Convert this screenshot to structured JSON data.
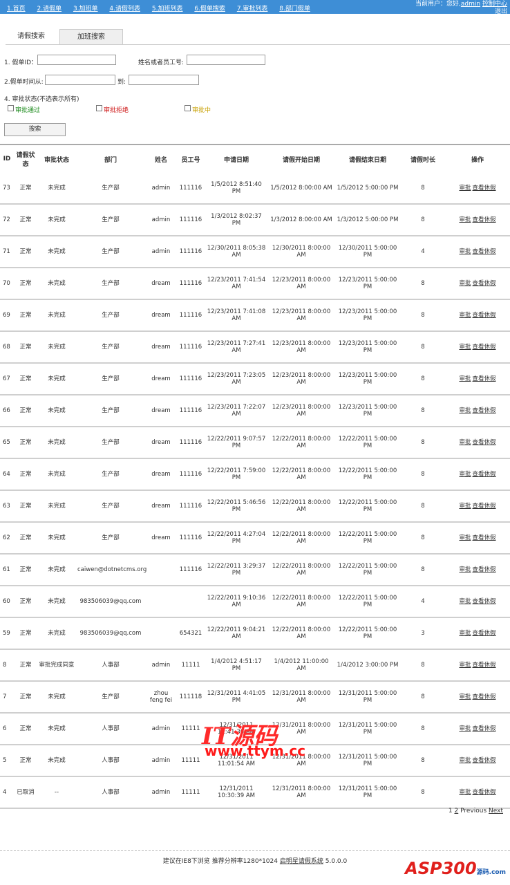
{
  "topnav": {
    "items": [
      "1.首页",
      "2.请假单",
      "3.加班单",
      "4.请假列表",
      "5.加班列表",
      "6.假单搜索",
      "7.审批列表",
      "8.部门假单"
    ],
    "user_prefix": "当前用户：您好,",
    "user_name": "admin",
    "control_center": "控制中心",
    "logout": "退出"
  },
  "tabs": [
    "请假搜索",
    "加班搜索"
  ],
  "form": {
    "leave_id_label": "1. 假单ID：",
    "name_label": "姓名或者员工号:",
    "time_from_label": "2.假单时间从:",
    "time_to_label": "到:",
    "status_label": "4. 审批状态(不选表示所有)",
    "status_options": [
      {
        "label": "审批通过",
        "color": "#1a8a1a"
      },
      {
        "label": "审批拒绝",
        "color": "#cc1111"
      },
      {
        "label": "审批中",
        "color": "#c8a000"
      }
    ],
    "search_button": "搜索"
  },
  "table": {
    "headers": [
      "ID",
      "请假状态",
      "审批状态",
      "部门",
      "姓名",
      "员工号",
      "申请日期",
      "请假开始日期",
      "请假结束日期",
      "请假时长",
      "操作"
    ],
    "op_approve": "审批",
    "op_view": "查看休假",
    "rows": [
      [
        "73",
        "正常",
        "未完成",
        "生产部",
        "admin",
        "111116",
        "1/5/2012 8:51:40 PM",
        "1/5/2012 8:00:00 AM",
        "1/5/2012 5:00:00 PM",
        "8"
      ],
      [
        "72",
        "正常",
        "未完成",
        "生产部",
        "admin",
        "111116",
        "1/3/2012 8:02:37 PM",
        "1/3/2012 8:00:00 AM",
        "1/3/2012 5:00:00 PM",
        "8"
      ],
      [
        "71",
        "正常",
        "未完成",
        "生产部",
        "admin",
        "111116",
        "12/30/2011 8:05:38 AM",
        "12/30/2011 8:00:00 AM",
        "12/30/2011 5:00:00 PM",
        "4"
      ],
      [
        "70",
        "正常",
        "未完成",
        "生产部",
        "dream",
        "111116",
        "12/23/2011 7:41:54 AM",
        "12/23/2011 8:00:00 AM",
        "12/23/2011 5:00:00 PM",
        "8"
      ],
      [
        "69",
        "正常",
        "未完成",
        "生产部",
        "dream",
        "111116",
        "12/23/2011 7:41:08 AM",
        "12/23/2011 8:00:00 AM",
        "12/23/2011 5:00:00 PM",
        "8"
      ],
      [
        "68",
        "正常",
        "未完成",
        "生产部",
        "dream",
        "111116",
        "12/23/2011 7:27:41 AM",
        "12/23/2011 8:00:00 AM",
        "12/23/2011 5:00:00 PM",
        "8"
      ],
      [
        "67",
        "正常",
        "未完成",
        "生产部",
        "dream",
        "111116",
        "12/23/2011 7:23:05 AM",
        "12/23/2011 8:00:00 AM",
        "12/23/2011 5:00:00 PM",
        "8"
      ],
      [
        "66",
        "正常",
        "未完成",
        "生产部",
        "dream",
        "111116",
        "12/23/2011 7:22:07 AM",
        "12/23/2011 8:00:00 AM",
        "12/23/2011 5:00:00 PM",
        "8"
      ],
      [
        "65",
        "正常",
        "未完成",
        "生产部",
        "dream",
        "111116",
        "12/22/2011 9:07:57 PM",
        "12/22/2011 8:00:00 AM",
        "12/22/2011 5:00:00 PM",
        "8"
      ],
      [
        "64",
        "正常",
        "未完成",
        "生产部",
        "dream",
        "111116",
        "12/22/2011 7:59:00 PM",
        "12/22/2011 8:00:00 AM",
        "12/22/2011 5:00:00 PM",
        "8"
      ],
      [
        "63",
        "正常",
        "未完成",
        "生产部",
        "dream",
        "111116",
        "12/22/2011 5:46:56 PM",
        "12/22/2011 8:00:00 AM",
        "12/22/2011 5:00:00 PM",
        "8"
      ],
      [
        "62",
        "正常",
        "未完成",
        "生产部",
        "dream",
        "111116",
        "12/22/2011 4:27:04 PM",
        "12/22/2011 8:00:00 AM",
        "12/22/2011 5:00:00 PM",
        "8"
      ],
      [
        "61",
        "正常",
        "未完成",
        "caiwen@dotnetcms.org",
        "",
        "111116",
        "12/22/2011 3:29:37 PM",
        "12/22/2011 8:00:00 AM",
        "12/22/2011 5:00:00 PM",
        "8"
      ],
      [
        "60",
        "正常",
        "未完成",
        "983506039@qq.com",
        "",
        "",
        "12/22/2011 9:10:36 AM",
        "12/22/2011 8:00:00 AM",
        "12/22/2011 5:00:00 PM",
        "4"
      ],
      [
        "59",
        "正常",
        "未完成",
        "983506039@qq.com",
        "",
        "654321",
        "12/22/2011 9:04:21 AM",
        "12/22/2011 8:00:00 AM",
        "12/22/2011 5:00:00 PM",
        "3"
      ],
      [
        "8",
        "正常",
        "审批完成同意",
        "人事部",
        "admin",
        "11111",
        "1/4/2012 4:51:17 PM",
        "1/4/2012 11:00:00 AM",
        "1/4/2012 3:00:00 PM",
        "8"
      ],
      [
        "7",
        "正常",
        "未完成",
        "生产部",
        "zhou feng fei",
        "111118",
        "12/31/2011 4:41:05 PM",
        "12/31/2011 8:00:00 AM",
        "12/31/2011 5:00:00 PM",
        "8"
      ],
      [
        "6",
        "正常",
        "未完成",
        "人事部",
        "admin",
        "11111",
        "12/31/2011 11:41:30 AM",
        "12/31/2011 8:00:00 AM",
        "12/31/2011 5:00:00 PM",
        "8"
      ],
      [
        "5",
        "正常",
        "未完成",
        "人事部",
        "admin",
        "11111",
        "12/31/2011 11:01:54 AM",
        "12/31/2011 8:00:00 AM",
        "12/31/2011 5:00:00 PM",
        "8"
      ],
      [
        "4",
        "已取消",
        "--",
        "人事部",
        "admin",
        "11111",
        "12/31/2011 10:30:39 AM",
        "12/31/2011 8:00:00 AM",
        "12/31/2011 5:00:00 PM",
        "8"
      ]
    ]
  },
  "pager": {
    "current": "1",
    "next_page": "2",
    "previous": "Previous",
    "next": "Next"
  },
  "footer": {
    "text": "建议在IE8下浏览  推荐分辨率1280*1024",
    "system_link": "启明星请假系统",
    "version": "5.0.0.0"
  },
  "watermark": {
    "line1": "IT源码",
    "line2": "www.ttym.cc"
  },
  "logo": {
    "text": "ASP300",
    "sub": "源码.com"
  },
  "colors": {
    "topbar": "#3e8ed6",
    "normal_green": "#1a8a1a",
    "pending_yellow": "#c8a000"
  }
}
